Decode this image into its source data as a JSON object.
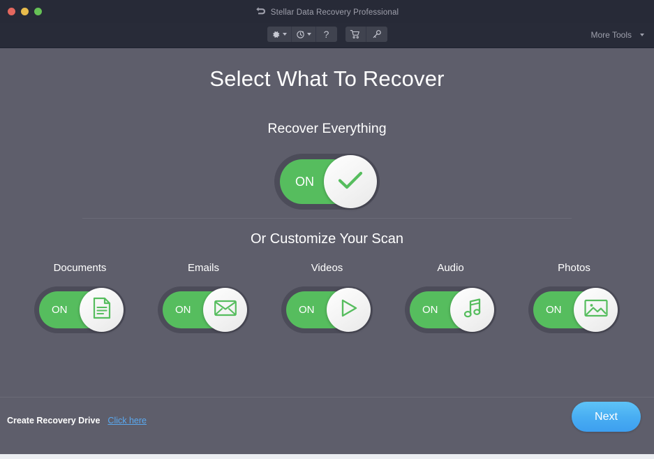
{
  "window": {
    "title": "Stellar Data Recovery Professional",
    "title_icon": "undo-arrow-icon",
    "controls": {
      "close": "close-window-button",
      "minimize": "minimize-window-button",
      "maximize": "maximize-window-button"
    }
  },
  "toolbar": {
    "buttons": [
      {
        "name": "settings-button",
        "icon": "gear-icon",
        "has_caret": true
      },
      {
        "name": "history-button",
        "icon": "clock-refresh-icon",
        "has_caret": true
      },
      {
        "name": "help-button",
        "icon": "question-mark-icon",
        "label": "?",
        "has_caret": false
      },
      {
        "name": "cart-button",
        "icon": "shopping-cart-icon",
        "has_caret": false
      },
      {
        "name": "activation-button",
        "icon": "key-icon",
        "has_caret": false
      }
    ],
    "more_tools_label": "More Tools"
  },
  "main": {
    "page_title": "Select What To Recover",
    "recover_everything_label": "Recover Everything",
    "customize_label": "Or Customize Your Scan",
    "master_toggle": {
      "state_label": "ON",
      "icon": "checkmark-icon",
      "enabled": true
    },
    "categories": [
      {
        "label": "Documents",
        "state_label": "ON",
        "icon": "document-icon",
        "enabled": true
      },
      {
        "label": "Emails",
        "state_label": "ON",
        "icon": "envelope-icon",
        "enabled": true
      },
      {
        "label": "Videos",
        "state_label": "ON",
        "icon": "play-triangle-icon",
        "enabled": true
      },
      {
        "label": "Audio",
        "state_label": "ON",
        "icon": "music-note-icon",
        "enabled": true
      },
      {
        "label": "Photos",
        "state_label": "ON",
        "icon": "image-icon",
        "enabled": true
      }
    ]
  },
  "footer": {
    "recovery_drive_label": "Create Recovery Drive",
    "click_here_label": "Click here",
    "next_label": "Next"
  },
  "colors": {
    "titlebar_bg": "#272a37",
    "toolbar_bg": "#282b38",
    "body_bg": "#5e5e6b",
    "toggle_track": "#4c4c59",
    "toggle_green": "#56bd5e",
    "link_blue": "#5aa9f0",
    "next_blue": "#49aef2"
  }
}
